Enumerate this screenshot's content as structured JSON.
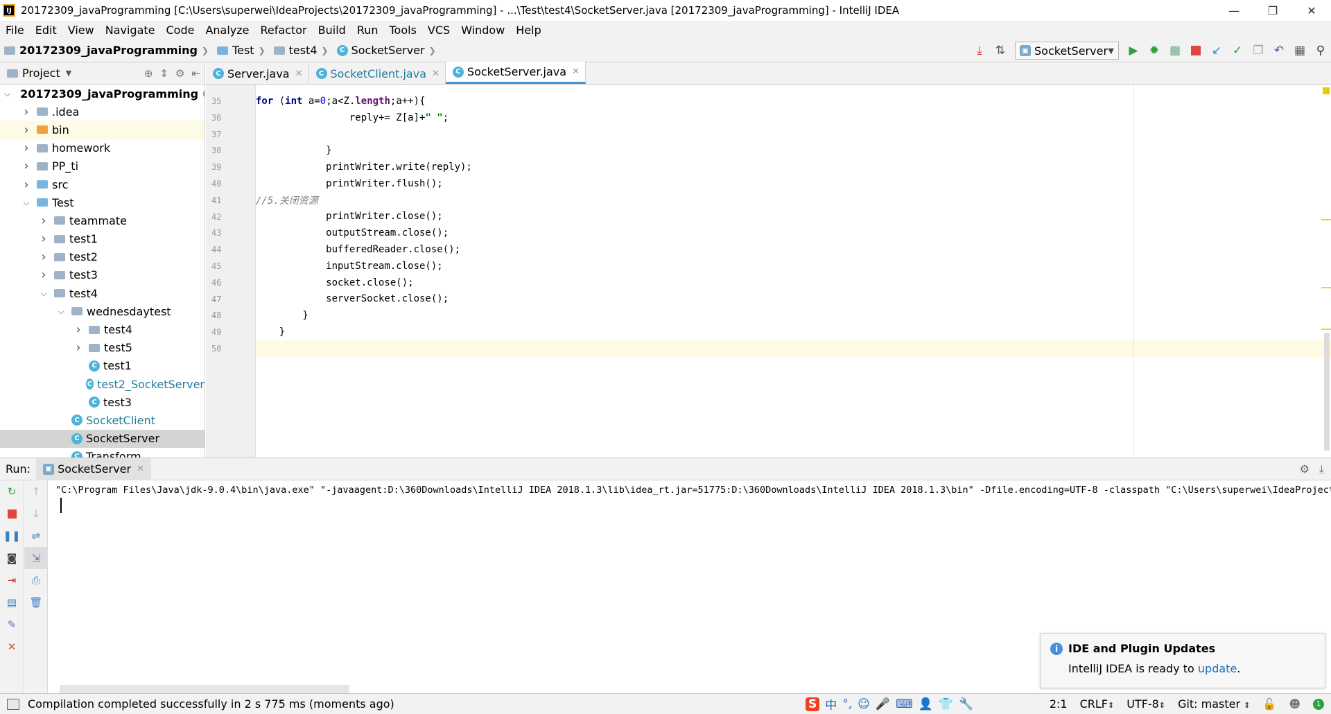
{
  "window": {
    "title": "20172309_javaProgramming [C:\\Users\\superwei\\IdeaProjects\\20172309_javaProgramming] - ...\\Test\\test4\\SocketServer.java [20172309_javaProgramming] - IntelliJ IDEA",
    "minimize": "—",
    "maximize": "❐",
    "close": "✕"
  },
  "menu": [
    "File",
    "Edit",
    "View",
    "Navigate",
    "Code",
    "Analyze",
    "Refactor",
    "Build",
    "Run",
    "Tools",
    "VCS",
    "Window",
    "Help"
  ],
  "breadcrumb": {
    "project": "20172309_javaProgramming",
    "folder1": "Test",
    "folder2": "test4",
    "file": "SocketServer"
  },
  "toolbar": {
    "run_config": "SocketServer",
    "accent_run": "#2ea043",
    "accent_stop": "#e0463c"
  },
  "project_panel": {
    "title": "Project",
    "path_hint": "C:\\"
  },
  "tree": [
    {
      "label": "20172309_javaProgramming",
      "depth": 0,
      "arrow": "open",
      "kind": "module",
      "bold": true
    },
    {
      "label": ".idea",
      "depth": 1,
      "arrow": "closed",
      "kind": "folder"
    },
    {
      "label": "bin",
      "depth": 1,
      "arrow": "closed",
      "kind": "folder-orange"
    },
    {
      "label": "homework",
      "depth": 1,
      "arrow": "closed",
      "kind": "folder"
    },
    {
      "label": "PP_ti",
      "depth": 1,
      "arrow": "closed",
      "kind": "folder"
    },
    {
      "label": "src",
      "depth": 1,
      "arrow": "closed",
      "kind": "folder-blue"
    },
    {
      "label": "Test",
      "depth": 1,
      "arrow": "open",
      "kind": "folder-blue"
    },
    {
      "label": "teammate",
      "depth": 2,
      "arrow": "closed",
      "kind": "package"
    },
    {
      "label": "test1",
      "depth": 2,
      "arrow": "closed",
      "kind": "package"
    },
    {
      "label": "test2",
      "depth": 2,
      "arrow": "closed",
      "kind": "package"
    },
    {
      "label": "test3",
      "depth": 2,
      "arrow": "closed",
      "kind": "package"
    },
    {
      "label": "test4",
      "depth": 2,
      "arrow": "open",
      "kind": "package"
    },
    {
      "label": "wednesdaytest",
      "depth": 3,
      "arrow": "open",
      "kind": "package"
    },
    {
      "label": "test4",
      "depth": 4,
      "arrow": "closed",
      "kind": "package"
    },
    {
      "label": "test5",
      "depth": 4,
      "arrow": "closed",
      "kind": "package"
    },
    {
      "label": "test1",
      "depth": 4,
      "arrow": "none",
      "kind": "class"
    },
    {
      "label": "test2_SocketServer",
      "depth": 4,
      "arrow": "none",
      "kind": "class",
      "teal": true
    },
    {
      "label": "test3",
      "depth": 4,
      "arrow": "none",
      "kind": "class"
    },
    {
      "label": "SocketClient",
      "depth": 3,
      "arrow": "none",
      "kind": "class",
      "teal": true
    },
    {
      "label": "SocketServer",
      "depth": 3,
      "arrow": "none",
      "kind": "class"
    },
    {
      "label": "Transform",
      "depth": 3,
      "arrow": "none",
      "kind": "class"
    }
  ],
  "tabs": [
    {
      "label": "Server.java",
      "teal": false
    },
    {
      "label": "SocketClient.java",
      "teal": true
    },
    {
      "label": "SocketServer.java",
      "teal": false,
      "active": true
    }
  ],
  "code_lines": [
    {
      "n": "35",
      "html": "        <span class=\"kw\">for</span> (<span class=\"kw\">int</span> a=<span class=\"num\">0</span>;a&lt;Z.<span class=\"field\">length</span>;a++){"
    },
    {
      "n": "36",
      "html": "            reply+= Z[a]+<span class=\"str\">\" \"</span>;"
    },
    {
      "n": "37",
      "html": ""
    },
    {
      "n": "38",
      "html": "        }"
    },
    {
      "n": "39",
      "html": "        printWriter.write(reply);"
    },
    {
      "n": "40",
      "html": "        printWriter.flush();"
    },
    {
      "n": "41",
      "html": "        <span class=\"cmt\">//5.关闭资源</span>"
    },
    {
      "n": "42",
      "html": "        printWriter.close();"
    },
    {
      "n": "43",
      "html": "        outputStream.close();"
    },
    {
      "n": "44",
      "html": "        bufferedReader.close();"
    },
    {
      "n": "45",
      "html": "        inputStream.close();"
    },
    {
      "n": "46",
      "html": "        socket.close();"
    },
    {
      "n": "47",
      "html": "        serverSocket.close();"
    },
    {
      "n": "48",
      "html": "    }"
    },
    {
      "n": "49",
      "html": "}"
    },
    {
      "n": "50",
      "html": "",
      "current": true
    }
  ],
  "run": {
    "label": "Run:",
    "tab": "SocketServer",
    "console_line": "\"C:\\Program Files\\Java\\jdk-9.0.4\\bin\\java.exe\" \"-javaagent:D:\\360Downloads\\IntelliJ IDEA 2018.1.3\\lib\\idea_rt.jar=51775:D:\\360Downloads\\IntelliJ IDEA 2018.1.3\\bin\" -Dfile.encoding=UTF-8 -classpath \"C:\\Users\\superwei\\IdeaProjects\\"
  },
  "notification": {
    "title": "IDE and Plugin Updates",
    "body": "IntelliJ IDEA is ready to ",
    "link": "update",
    "tail": "."
  },
  "status": {
    "message": "Compilation completed successfully in 2 s 775 ms (moments ago)",
    "position": "2:1",
    "line_sep": "CRLF",
    "encoding": "UTF-8",
    "vcs": "Git: master"
  },
  "ime": {
    "sogou": "S",
    "lang": "中",
    "punct": "°,"
  }
}
